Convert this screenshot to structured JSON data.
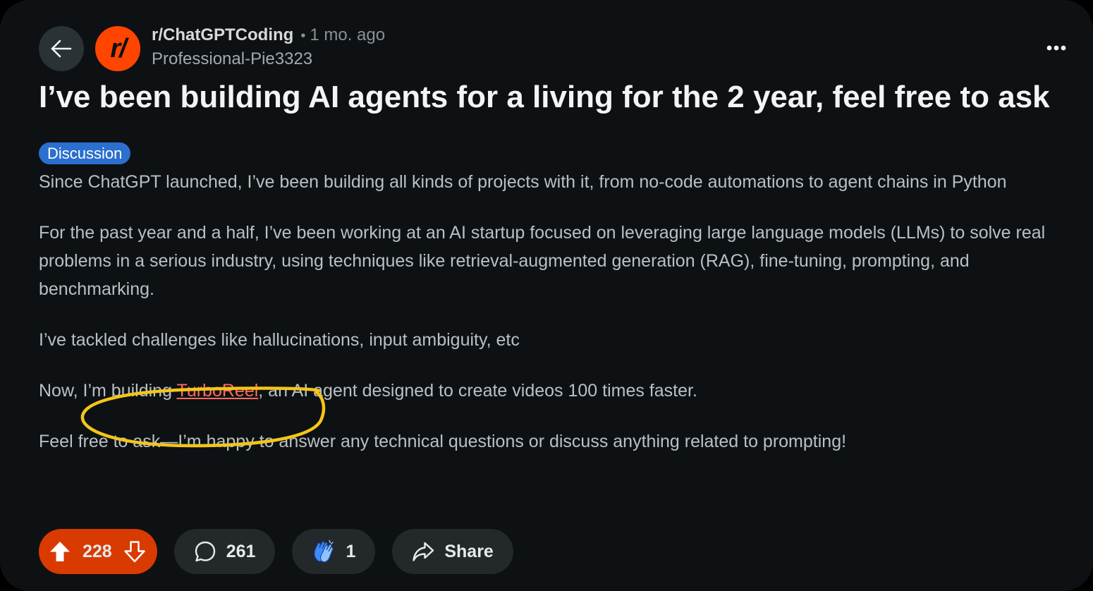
{
  "header": {
    "subreddit": "r/ChatGPTCoding",
    "separator": "•",
    "time_ago": "1 mo. ago",
    "author": "Professional-Pie3323",
    "avatar_text": "r/"
  },
  "post": {
    "title": "I’ve been building AI agents for a living for the 2 year, feel free to ask",
    "flair": "Discussion",
    "paragraphs": {
      "p1": "Since ChatGPT launched, I’ve been building all kinds of projects with it, from no-code automations to agent chains in Python",
      "p2": "For the past year and a half, I’ve been working at an AI startup focused on leveraging large language models (LLMs) to solve real problems in a serious industry, using techniques like retrieval-augmented generation (RAG), fine-tuning, prompting, and benchmarking.",
      "p3": "I’ve tackled challenges like hallucinations, input ambiguity, etc",
      "p4_before": "Now, I’m building ",
      "p4_link": "TurboReel",
      "p4_after": ", an AI agent designed to create videos 100 times faster.",
      "p5": "Feel free to ask—I’m happy to answer any technical questions or discuss anything related to prompting!"
    }
  },
  "actions": {
    "votes": "228",
    "comments": "261",
    "awards": "1",
    "share_label": "Share"
  },
  "icons": {
    "back": "arrow-left-icon",
    "more": "more-horizontal-icon",
    "upvote": "upvote-icon",
    "downvote": "downvote-icon",
    "comment": "comment-icon",
    "award": "clapping-hands-icon",
    "share": "share-icon"
  },
  "colors": {
    "background": "#0e1113",
    "accent_orange": "#ff4500",
    "vote_pill": "#d93a00",
    "flair_blue": "#2b6fcf",
    "link": "#ff6b5e",
    "annotation_yellow": "#f5c518"
  }
}
